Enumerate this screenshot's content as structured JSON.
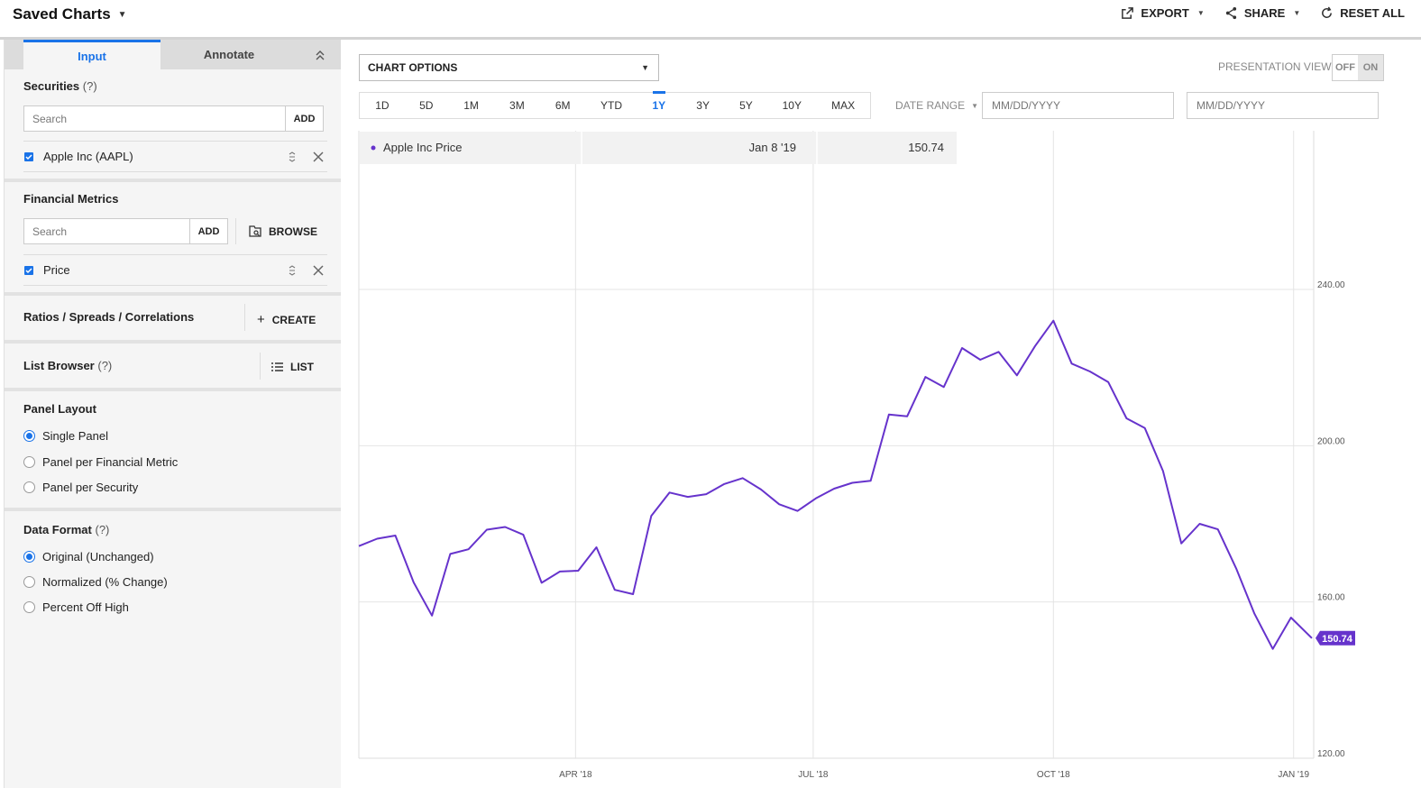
{
  "header": {
    "title": "Saved Charts",
    "export_label": "EXPORT",
    "share_label": "SHARE",
    "reset_label": "RESET ALL"
  },
  "sidebar": {
    "tabs": [
      {
        "label": "Input"
      },
      {
        "label": "Annotate"
      }
    ],
    "securities": {
      "title": "Securities",
      "help": "(?)",
      "search_placeholder": "Search",
      "add_label": "ADD",
      "items": [
        {
          "label": "Apple Inc (AAPL)",
          "checked": true
        }
      ]
    },
    "financial_metrics": {
      "title": "Financial Metrics",
      "search_placeholder": "Search",
      "add_label": "ADD",
      "browse_label": "BROWSE",
      "items": [
        {
          "label": "Price",
          "checked": true
        }
      ]
    },
    "ratios": {
      "title": "Ratios / Spreads / Correlations",
      "create_label": "CREATE"
    },
    "list_browser": {
      "title": "List Browser",
      "help": "(?)",
      "list_label": "LIST"
    },
    "panel_layout": {
      "title": "Panel Layout",
      "options": [
        {
          "label": "Single Panel",
          "selected": true
        },
        {
          "label": "Panel per Financial Metric",
          "selected": false
        },
        {
          "label": "Panel per Security",
          "selected": false
        }
      ]
    },
    "data_format": {
      "title": "Data Format",
      "help": "(?)",
      "options": [
        {
          "label": "Original (Unchanged)",
          "selected": true
        },
        {
          "label": "Normalized (% Change)",
          "selected": false
        },
        {
          "label": "Percent Off High",
          "selected": false
        }
      ]
    }
  },
  "toolbar": {
    "chart_options_label": "CHART OPTIONS",
    "presentation_view_label": "PRESENTATION VIEW",
    "toggle_off": "OFF",
    "toggle_on": "ON",
    "toggle_selected": "ON",
    "ranges": [
      "1D",
      "5D",
      "1M",
      "3M",
      "6M",
      "YTD",
      "1Y",
      "3Y",
      "5Y",
      "10Y",
      "MAX"
    ],
    "active_range": "1Y",
    "date_range_label": "DATE RANGE",
    "date_placeholder": "MM/DD/YYYY"
  },
  "colors": {
    "accent": "#1a73e8",
    "series": "#6633cc"
  },
  "chart_data": {
    "type": "line",
    "series": [
      {
        "name": "Apple Inc Price",
        "x": [
          "2018-01-08",
          "2018-01-15",
          "2018-01-22",
          "2018-01-29",
          "2018-02-05",
          "2018-02-12",
          "2018-02-19",
          "2018-02-26",
          "2018-03-05",
          "2018-03-12",
          "2018-03-19",
          "2018-03-26",
          "2018-04-02",
          "2018-04-09",
          "2018-04-16",
          "2018-04-23",
          "2018-04-30",
          "2018-05-07",
          "2018-05-14",
          "2018-05-21",
          "2018-05-28",
          "2018-06-04",
          "2018-06-11",
          "2018-06-18",
          "2018-06-25",
          "2018-07-02",
          "2018-07-09",
          "2018-07-16",
          "2018-07-23",
          "2018-07-30",
          "2018-08-06",
          "2018-08-13",
          "2018-08-20",
          "2018-08-27",
          "2018-09-03",
          "2018-09-10",
          "2018-09-17",
          "2018-09-24",
          "2018-10-01",
          "2018-10-08",
          "2018-10-15",
          "2018-10-22",
          "2018-10-29",
          "2018-11-05",
          "2018-11-12",
          "2018-11-19",
          "2018-11-26",
          "2018-12-03",
          "2018-12-10",
          "2018-12-17",
          "2018-12-24",
          "2018-12-31",
          "2019-01-08"
        ],
        "values": [
          174.3,
          176.2,
          177.0,
          165.0,
          156.5,
          172.3,
          173.5,
          178.5,
          179.2,
          177.2,
          164.9,
          167.8,
          168.0,
          174.0,
          163.1,
          162.0,
          182.0,
          188.0,
          186.9,
          187.6,
          190.2,
          191.7,
          188.8,
          185.0,
          183.3,
          186.5,
          189.0,
          190.5,
          191.0,
          208.0,
          207.5,
          217.6,
          215.0,
          225.0,
          222.0,
          224.0,
          218.0,
          225.5,
          232.0,
          221.0,
          219.0,
          216.3,
          207.0,
          204.5,
          193.5,
          175.0,
          180.0,
          178.6,
          168.6,
          157.0,
          148.0,
          156.0,
          150.74
        ]
      }
    ],
    "ylim": [
      120,
      240
    ],
    "yticks": [
      "120.00",
      "160.00",
      "200.00",
      "240.00"
    ],
    "xticks": [
      "APR '18",
      "JUL '18",
      "OCT '18",
      "JAN '19"
    ],
    "last_value_label": "150.74",
    "tooltip": {
      "series": "Apple Inc Price",
      "date": "Jan 8 '19",
      "value": "150.74"
    },
    "grid": true
  }
}
